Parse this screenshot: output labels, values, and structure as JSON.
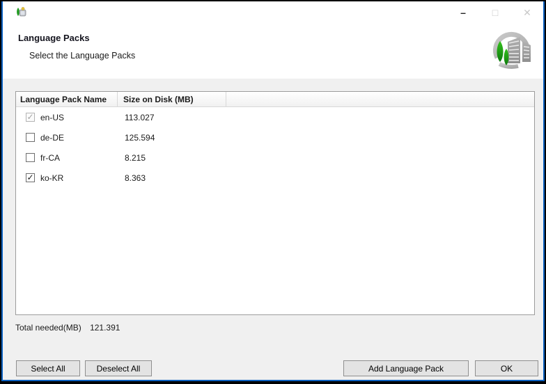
{
  "window": {
    "controls": {
      "minimize": "–",
      "maximize": "□",
      "close": "✕"
    }
  },
  "header": {
    "title": "Language Packs",
    "subtitle": "Select the Language Packs"
  },
  "table": {
    "columns": [
      "Language Pack Name",
      "Size on Disk (MB)"
    ],
    "rows": [
      {
        "name": "en-US",
        "size": "113.027",
        "checked": true,
        "disabled": true
      },
      {
        "name": "de-DE",
        "size": "125.594",
        "checked": false,
        "disabled": false
      },
      {
        "name": "fr-CA",
        "size": "8.215",
        "checked": false,
        "disabled": false
      },
      {
        "name": "ko-KR",
        "size": "8.363",
        "checked": true,
        "disabled": false
      }
    ],
    "checkmark": "✓"
  },
  "total": {
    "label": "Total needed(MB)",
    "value": "121.391"
  },
  "buttons": {
    "select_all": "Select All",
    "deselect_all": "Deselect All",
    "add_language_pack": "Add Language Pack",
    "ok": "OK"
  },
  "icons": {
    "titlebar_icon": "mdt-app-icon",
    "logo": "mdt-deployment-logo"
  },
  "colors": {
    "accent_border": "#0a60c0",
    "outer_border": "#000000",
    "content_bg": "#f0f0f0",
    "table_border": "#9c9c9c",
    "button_bg": "#e3e3e3",
    "button_border": "#8f8f8f",
    "tree_green": "#12a012",
    "logo_gray": "#b5b5b5",
    "disabled_control": "#c9c9c9"
  }
}
